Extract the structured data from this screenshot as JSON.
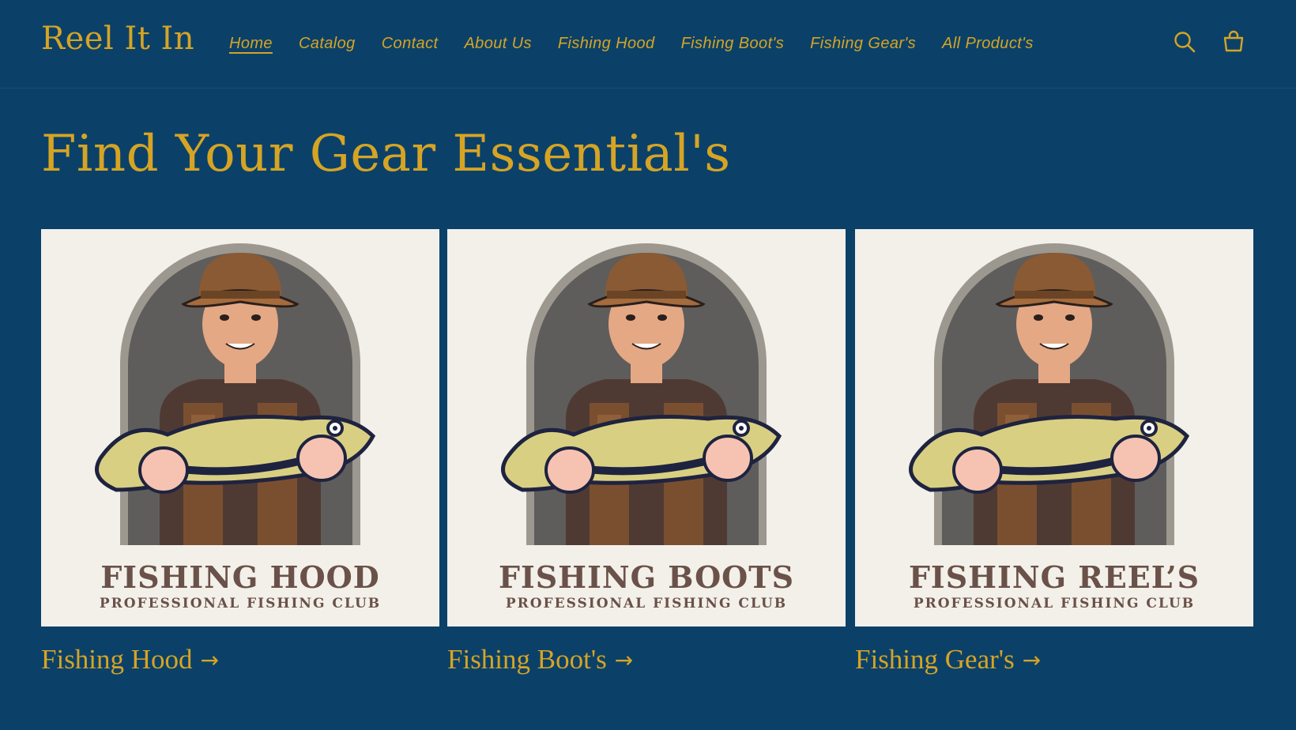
{
  "header": {
    "logo": "Reel It In",
    "nav": [
      "Home",
      "Catalog",
      "Contact",
      "About Us",
      "Fishing Hood",
      "Fishing Boot's",
      "Fishing Gear's",
      "All Product's"
    ],
    "active_nav": "Home",
    "icons": [
      "search-icon",
      "cart-icon"
    ]
  },
  "main": {
    "title": "Find Your Gear Essential's",
    "cards": [
      {
        "badge_title": "FISHING HOOD",
        "badge_sub": "PROFESSIONAL FISHING CLUB",
        "link": "Fishing Hood",
        "arrow": "→"
      },
      {
        "badge_title": "FISHING BOOTS",
        "badge_sub": "PROFESSIONAL FISHING CLUB",
        "link": "Fishing Boot's",
        "arrow": "→"
      },
      {
        "badge_title": "FISHING REEL’S",
        "badge_sub": "PROFESSIONAL FISHING CLUB",
        "link": "Fishing Gear's",
        "arrow": "→"
      }
    ]
  },
  "colors": {
    "background": "#0b4169",
    "accent": "#d6a424",
    "card_bg": "#f2f0e9",
    "badge_text": "#6a5149"
  }
}
